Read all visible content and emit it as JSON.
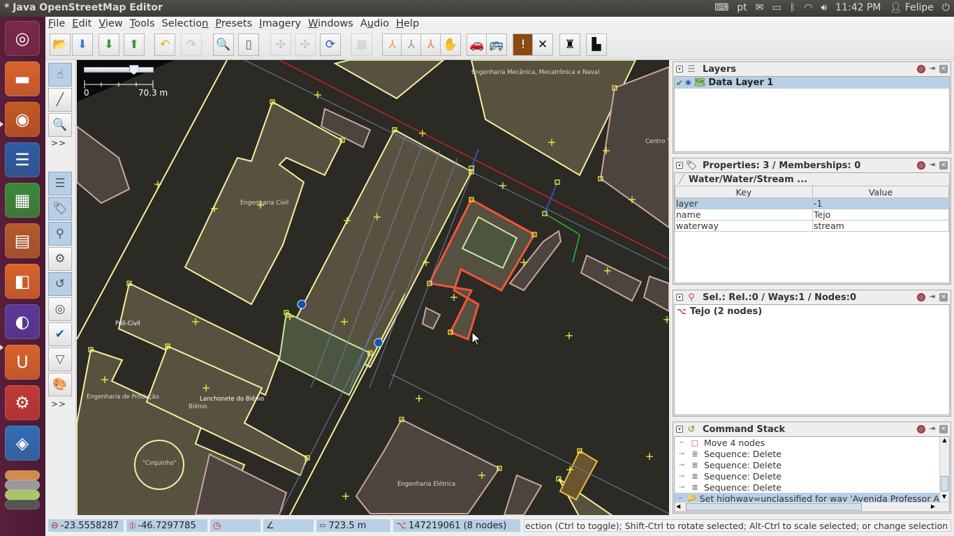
{
  "window": {
    "title": "* Java OpenStreetMap Editor"
  },
  "top_panel": {
    "keyboard_layout": "pt",
    "time": "11:42 PM",
    "user": "Felipe",
    "icons": [
      "keyboard-icon",
      "mail-icon",
      "battery-icon",
      "bluetooth-icon",
      "wifi-icon",
      "volume-icon",
      "user-icon",
      "power-icon"
    ]
  },
  "launcher": {
    "items": [
      {
        "name": "ubuntu-dash",
        "icon": "ubuntu-logo-icon",
        "color": "#7a2949"
      },
      {
        "name": "files",
        "icon": "folder-icon",
        "color": "#d9642a"
      },
      {
        "name": "firefox",
        "icon": "firefox-icon",
        "color": "#c45a22"
      },
      {
        "name": "libreoffice-writer",
        "icon": "writer-icon",
        "color": "#2b5fa3"
      },
      {
        "name": "libreoffice-calc",
        "icon": "calc-icon",
        "color": "#3a8b3a"
      },
      {
        "name": "libreoffice-impress",
        "icon": "impress-icon",
        "color": "#b65a2a"
      },
      {
        "name": "software-center",
        "icon": "shopping-bag-icon",
        "color": "#d9642a"
      },
      {
        "name": "eclipse",
        "icon": "eclipse-icon",
        "color": "#5a3a9a"
      },
      {
        "name": "ubuntu-one",
        "icon": "ubuntu-one-icon",
        "color": "#d9642a"
      },
      {
        "name": "system-settings",
        "icon": "settings-icon",
        "color": "#c33a33"
      },
      {
        "name": "dropbox",
        "icon": "dropbox-icon",
        "color": "#2f6fb5"
      }
    ]
  },
  "menubar": {
    "items": [
      {
        "label": "File",
        "ul": "F",
        "rest": "ile"
      },
      {
        "label": "Edit",
        "ul": "E",
        "rest": "dit"
      },
      {
        "label": "View",
        "ul": "V",
        "rest": "iew"
      },
      {
        "label": "Tools",
        "ul": "T",
        "rest": "ools"
      },
      {
        "label": "Selection",
        "pre": "Selectio",
        "ul": "n"
      },
      {
        "label": "Presets",
        "ul": "P",
        "rest": "resets"
      },
      {
        "label": "Imagery",
        "ul": "I",
        "rest": "magery"
      },
      {
        "label": "Windows",
        "ul": "W",
        "rest": "indows"
      },
      {
        "label": "Audio",
        "pre": "A",
        "ul": "u",
        "rest": "dio"
      },
      {
        "label": "Help",
        "ul": "H",
        "rest": "elp"
      }
    ]
  },
  "toolbar": {
    "buttons": [
      {
        "name": "open-file",
        "glyph": "📂",
        "enabled": true
      },
      {
        "name": "open-location",
        "glyph": "⬇",
        "enabled": true
      },
      {
        "name": "download",
        "glyph": "⬇",
        "enabled": true
      },
      {
        "name": "upload",
        "glyph": "⬆",
        "enabled": true
      },
      {
        "name": "undo",
        "glyph": "↶",
        "enabled": true
      },
      {
        "name": "redo",
        "glyph": "↷",
        "enabled": false
      },
      {
        "name": "preferences",
        "glyph": "🔍",
        "enabled": true
      },
      {
        "name": "toggle-panel",
        "glyph": "▯",
        "enabled": true
      },
      {
        "name": "split-way",
        "glyph": "✣",
        "enabled": false
      },
      {
        "name": "combine-way",
        "glyph": "✣",
        "enabled": false
      },
      {
        "name": "update-data",
        "glyph": "⟳",
        "enabled": true
      },
      {
        "name": "wms",
        "glyph": "▦",
        "enabled": false
      },
      {
        "name": "highway-preset",
        "glyph": "⅄",
        "enabled": true
      },
      {
        "name": "path-preset",
        "glyph": "⅄",
        "enabled": true
      },
      {
        "name": "junction-preset",
        "glyph": "⅄",
        "enabled": true
      },
      {
        "name": "barrier-preset",
        "glyph": "✋",
        "enabled": true
      },
      {
        "name": "car-preset",
        "glyph": "🚗",
        "enabled": true
      },
      {
        "name": "bus-preset",
        "glyph": "🚌",
        "enabled": true
      },
      {
        "name": "warning-preset",
        "glyph": "!",
        "enabled": true
      },
      {
        "name": "restaurant-preset",
        "glyph": "✕",
        "enabled": true
      },
      {
        "name": "castle-preset",
        "glyph": "♜",
        "enabled": true
      },
      {
        "name": "industrial-preset",
        "glyph": "▙",
        "enabled": true
      }
    ]
  },
  "side_toolbar": {
    "buttons": [
      {
        "name": "select-mode",
        "glyph": "☝",
        "active": true
      },
      {
        "name": "draw-mode",
        "glyph": "╱",
        "active": false
      },
      {
        "name": "zoom-mode",
        "glyph": "🔍",
        "active": false
      },
      {
        "name": "toggle-layers",
        "glyph": "☰",
        "active": true
      },
      {
        "name": "toggle-properties",
        "glyph": "🏷",
        "active": true
      },
      {
        "name": "toggle-selection-list",
        "glyph": "⚲",
        "active": true
      },
      {
        "name": "toggle-relations",
        "glyph": "⚙",
        "active": false
      },
      {
        "name": "toggle-command-stack",
        "glyph": "↺",
        "active": true
      },
      {
        "name": "toggle-conflicts",
        "glyph": "◎",
        "active": false
      },
      {
        "name": "validator",
        "glyph": "✔",
        "active": false
      },
      {
        "name": "filter",
        "glyph": "▽",
        "active": false
      },
      {
        "name": "map-paint",
        "glyph": "🎨",
        "active": false
      }
    ],
    "more_label": ">>"
  },
  "map": {
    "scale_zero": "0",
    "scale_label": "70.3 m",
    "zoom_slider_fraction": 0.72,
    "labels": [
      {
        "text": "Engenharia Mecânica, Mecatrônica e Naval"
      },
      {
        "text": "Engenharia Civil"
      },
      {
        "text": "Centro T"
      },
      {
        "text": "Poli-Civil"
      },
      {
        "text": "Engenharia de Produção"
      },
      {
        "text": "Lanchonete do Biênio"
      },
      {
        "text": "Biênio"
      },
      {
        "text": "\"Cirquinho\""
      },
      {
        "text": "Engenharia Elétrica"
      }
    ]
  },
  "panels": {
    "layers": {
      "title": "Layers",
      "items": [
        {
          "label": "Data Layer 1",
          "visible": true,
          "active": true
        }
      ]
    },
    "properties": {
      "title": "Properties: 3 / Memberships: 0",
      "preset": "Water/Water/Stream ...",
      "columns": [
        "Key",
        "Value"
      ],
      "rows": [
        {
          "key": "layer",
          "value": "-1",
          "selected": true
        },
        {
          "key": "name",
          "value": "Tejo",
          "selected": false
        },
        {
          "key": "waterway",
          "value": "stream",
          "selected": false
        }
      ]
    },
    "selection": {
      "title": "Sel.: Rel.:0 / Ways:1 / Nodes:0",
      "items": [
        {
          "label": "Tejo (2 nodes)"
        }
      ]
    },
    "command_stack": {
      "title": "Command Stack",
      "items": [
        {
          "label": "Move 4 nodes",
          "expandable": false,
          "icon": "move-icon",
          "selected": false
        },
        {
          "label": "Sequence: Delete",
          "expandable": true,
          "icon": "sequence-icon",
          "selected": false
        },
        {
          "label": "Sequence: Delete",
          "expandable": true,
          "icon": "sequence-icon",
          "selected": false
        },
        {
          "label": "Sequence: Delete",
          "expandable": true,
          "icon": "sequence-icon",
          "selected": false
        },
        {
          "label": "Sequence: Delete",
          "expandable": true,
          "icon": "sequence-icon",
          "selected": false
        },
        {
          "label": "Set highway=unclassified for way 'Avenida Professor A",
          "expandable": false,
          "icon": "key-icon",
          "selected": true
        }
      ]
    }
  },
  "statusbar": {
    "lat": "-23.5558287",
    "lon": "-46.7297785",
    "heading": "",
    "angle": "",
    "distance": "723.5 m",
    "way_info": "147219061 (8 nodes)",
    "help": "ection (Ctrl to toggle); Shift-Ctrl to rotate selected; Alt-Ctrl to scale selected; or change selection"
  }
}
